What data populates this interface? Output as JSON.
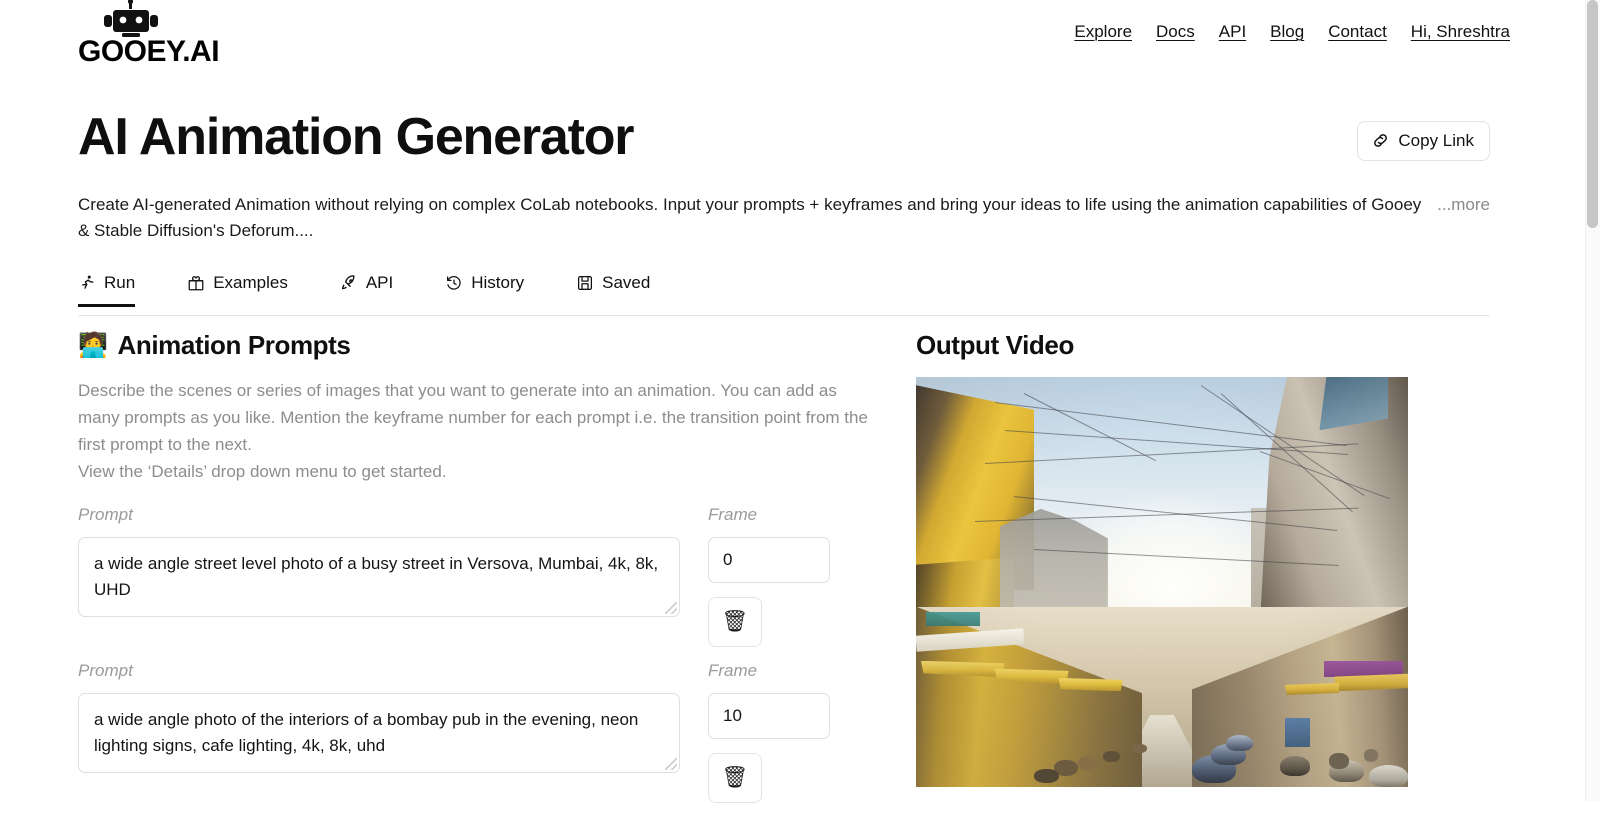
{
  "header": {
    "logo_text": "GOOEY.AI",
    "logo_icon": "robot-icon",
    "nav": [
      {
        "label": "Explore"
      },
      {
        "label": "Docs"
      },
      {
        "label": "API"
      },
      {
        "label": "Blog"
      },
      {
        "label": "Contact"
      },
      {
        "label": "Hi, Shreshtra"
      }
    ]
  },
  "title": "AI Animation Generator",
  "copy_link": {
    "label": "Copy Link",
    "icon": "link-icon"
  },
  "description": {
    "text": "Create AI-generated Animation without relying on complex CoLab notebooks. Input your prompts + keyframes and bring your ideas to life using the animation capabilities of Gooey & Stable Diffusion's Deforum....",
    "more_label": "...more"
  },
  "tabs": [
    {
      "label": "Run",
      "icon": "running-person-icon",
      "active": true
    },
    {
      "label": "Examples",
      "icon": "gift-icon",
      "active": false
    },
    {
      "label": "API",
      "icon": "rocket-icon",
      "active": false
    },
    {
      "label": "History",
      "icon": "clock-rewind-icon",
      "active": false
    },
    {
      "label": "Saved",
      "icon": "save-floppy-icon",
      "active": false
    }
  ],
  "prompts_section": {
    "emoji": "🧑‍💻",
    "heading": "Animation Prompts",
    "helper_line_1": "Describe the scenes or series of images that you want to generate into an animation. You can add as many prompts as you like. Mention the keyframe number for each prompt i.e. the transition point from the first prompt to the next.",
    "helper_line_2": "View the ‘Details’ drop down menu to get started.",
    "prompt_label": "Prompt",
    "frame_label": "Frame",
    "delete_icon": "🗑",
    "rows": [
      {
        "prompt": "a wide angle street level photo of a busy street in Versova, Mumbai, 4k, 8k, UHD",
        "frame": "0"
      },
      {
        "prompt": "a wide angle photo of the interiors of a bombay pub in the evening, neon lighting signs, cafe lighting, 4k, 8k, uhd",
        "frame": "10"
      }
    ]
  },
  "output": {
    "heading": "Output Video",
    "image_alt": "busy street scene in Versova Mumbai with yellow shopfronts, tangled overhead power lines and motorbikes"
  },
  "colors": {
    "text": "#1a1a1a",
    "muted": "#8d8d8d",
    "border": "#dfdfdf",
    "accent": "#111111"
  }
}
